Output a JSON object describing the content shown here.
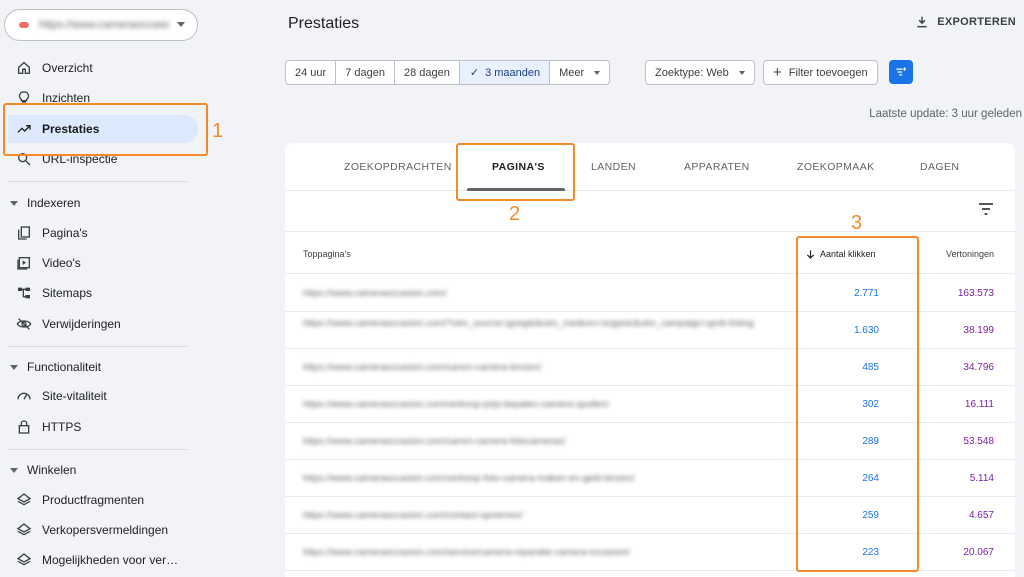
{
  "sidebar": {
    "property": "https://www.cameraoccasion.com",
    "items": [
      {
        "label": "Overzicht",
        "icon": "home-icon"
      },
      {
        "label": "Inzichten",
        "icon": "lightbulb-icon"
      },
      {
        "label": "Prestaties",
        "icon": "trending-up-icon"
      },
      {
        "label": "URL-inspectie",
        "icon": "search-icon"
      }
    ],
    "sections": [
      {
        "title": "Indexeren",
        "items": [
          {
            "label": "Pagina's",
            "icon": "pages-icon"
          },
          {
            "label": "Video's",
            "icon": "video-icon"
          },
          {
            "label": "Sitemaps",
            "icon": "sitemap-icon"
          },
          {
            "label": "Verwijderingen",
            "icon": "visibility-off-icon"
          }
        ]
      },
      {
        "title": "Functionaliteit",
        "items": [
          {
            "label": "Site-vitaliteit",
            "icon": "gauge-icon"
          },
          {
            "label": "HTTPS",
            "icon": "lock-icon"
          }
        ]
      },
      {
        "title": "Winkelen",
        "items": [
          {
            "label": "Productfragmenten",
            "icon": "diamond-icon"
          },
          {
            "label": "Verkopersvermeldingen",
            "icon": "diamond-icon"
          },
          {
            "label": "Mogelijkheden voor ver…",
            "icon": "diamond-icon"
          }
        ]
      }
    ]
  },
  "header": {
    "title": "Prestaties",
    "export_label": "EXPORTEREN"
  },
  "filters": {
    "date_options": [
      "24 uur",
      "7 dagen",
      "28 dagen",
      "3 maanden",
      "Meer"
    ],
    "selected": "3 maanden",
    "search_type": "Zoektype: Web",
    "add_filter": "Filter toevoegen"
  },
  "last_update": "Laatste update: 3 uur geleden",
  "tabs": [
    "ZOEKOPDRACHTEN",
    "PAGINA'S",
    "LANDEN",
    "APPARATEN",
    "ZOEKOPMAAK",
    "DAGEN"
  ],
  "active_tab": "PAGINA'S",
  "table": {
    "col_page": "Toppagina's",
    "col_clicks": "Aantal klikken",
    "col_impressions": "Vertoningen",
    "rows": [
      {
        "url": "https://www.cameraoccasion.com/",
        "clicks": "2.771",
        "impressions": "163.573"
      },
      {
        "url": "https://www.cameraoccasion.com/?utm_source=google&utm_medium=organic&utm_campaign=gmb-listing",
        "clicks": "1.630",
        "impressions": "38.199"
      },
      {
        "url": "https://www.cameraoccasion.com/canon-camera-lenzen/",
        "clicks": "485",
        "impressions": "34.796"
      },
      {
        "url": "https://www.cameraoccasion.com/verkoop-prijs-bepalen-camera-spullen/",
        "clicks": "302",
        "impressions": "16.111"
      },
      {
        "url": "https://www.cameraoccasion.com/canon-camera-fotocameras/",
        "clicks": "289",
        "impressions": "53.548"
      },
      {
        "url": "https://www.cameraoccasion.com/verkoop-foto-camera-maken-en-geld-lenzen/",
        "clicks": "264",
        "impressions": "5.114"
      },
      {
        "url": "https://www.cameraoccasion.com/contact-opnemen/",
        "clicks": "259",
        "impressions": "4.657"
      },
      {
        "url": "https://www.cameraoccasion.com/service/camera-reparatie-camera-occasion/",
        "clicks": "223",
        "impressions": "20.067"
      }
    ]
  },
  "annotations": [
    "1",
    "2",
    "3"
  ],
  "colors": {
    "accent": "#1a73e8",
    "clicks": "#1a73e8",
    "impressions": "#7b1fa2",
    "annotation": "#f28b2b"
  }
}
